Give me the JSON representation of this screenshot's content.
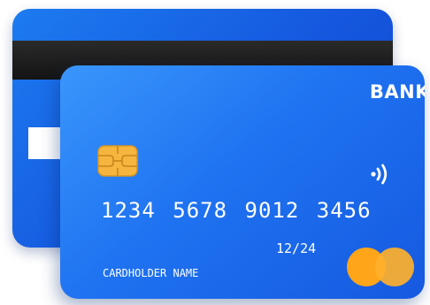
{
  "card_front": {
    "bank_name": "BANK",
    "card_number": "1234 5678 9012 3456",
    "expiry": "12/24",
    "cardholder": "CARDHOLDER NAME",
    "icons": {
      "chip": "chip-icon",
      "contactless": "contactless-icon",
      "network": "card-network-logo-icon"
    }
  },
  "colors": {
    "card_blue": "#1f73f1",
    "chip_gold": "#f5b53f",
    "network_orange": "#ffa51a",
    "stripe_black": "#141414"
  }
}
